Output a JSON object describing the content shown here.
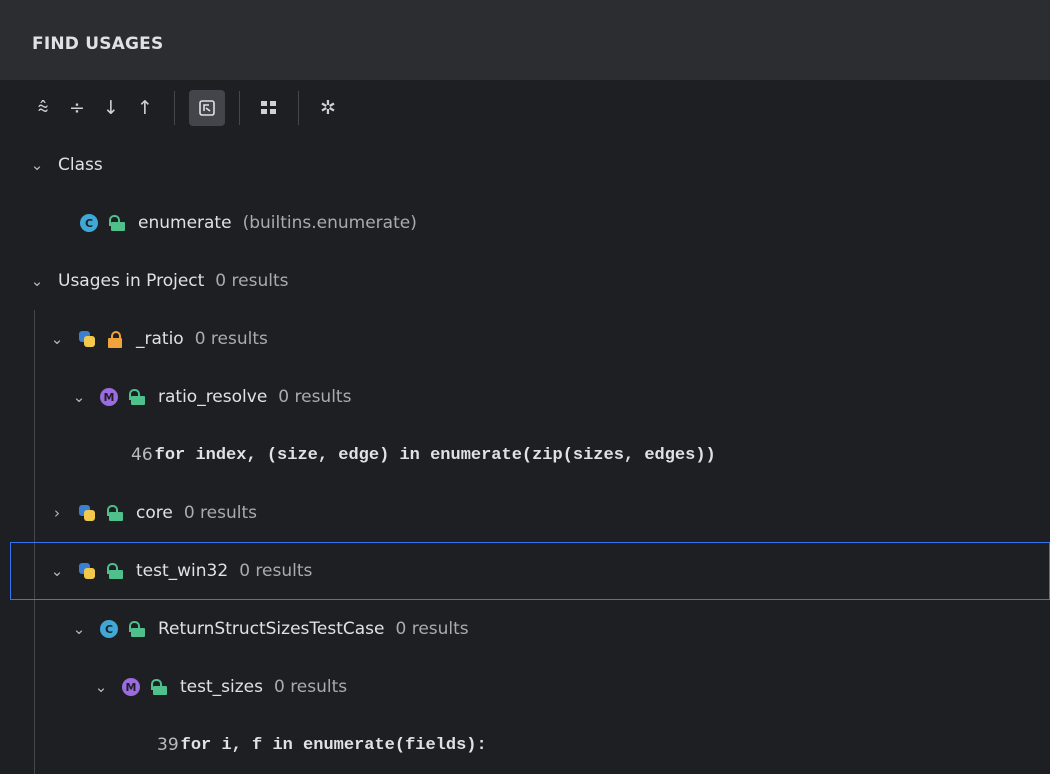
{
  "panel": {
    "title": "FIND USAGES"
  },
  "toolbar": {
    "buttons": [
      "expand-all",
      "collapse-all",
      "next-occurrence",
      "previous-occurrence",
      "group-by-module",
      "layout",
      "settings"
    ]
  },
  "tree": {
    "class_group": {
      "label": "Class"
    },
    "class_item": {
      "name": "enumerate",
      "qualifier": "(builtins.enumerate)"
    },
    "usages_group": {
      "label": "Usages in Project",
      "count": "0 results"
    },
    "ratio": {
      "name": "_ratio",
      "count": "0 results"
    },
    "ratio_resolve": {
      "name": "ratio_resolve",
      "count": "0 results"
    },
    "usage1": {
      "line": "46",
      "code": "for index, (size, edge) in enumerate(zip(sizes, edges))"
    },
    "core": {
      "name": "core",
      "count": "0 results"
    },
    "test_win32": {
      "name": "test_win32",
      "count": "0 results"
    },
    "testcase": {
      "name": "ReturnStructSizesTestCase",
      "count": "0 results"
    },
    "test_sizes": {
      "name": "test_sizes",
      "count": "0 results"
    },
    "usage2": {
      "line": "39",
      "code": "for i, f in enumerate(fields):"
    }
  },
  "colors": {
    "accent": "#3574f0",
    "background": "#1e1f22",
    "header": "#2b2d30"
  }
}
